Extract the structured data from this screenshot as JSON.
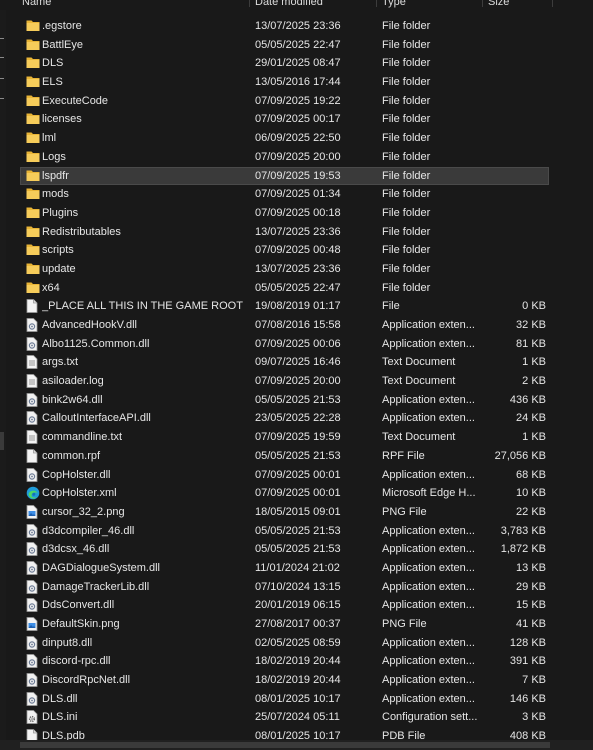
{
  "columns": {
    "name": "Name",
    "date_modified": "Date modified",
    "type": "Type",
    "size": "Size"
  },
  "files": [
    {
      "name": ".egstore",
      "date": "13/07/2025 23:36",
      "type": "File folder",
      "size": "",
      "icon": "folder-icon"
    },
    {
      "name": "BattlEye",
      "date": "05/05/2025 22:47",
      "type": "File folder",
      "size": "",
      "icon": "folder-icon"
    },
    {
      "name": "DLS",
      "date": "29/01/2025 08:47",
      "type": "File folder",
      "size": "",
      "icon": "folder-icon"
    },
    {
      "name": "ELS",
      "date": "13/05/2016 17:44",
      "type": "File folder",
      "size": "",
      "icon": "folder-icon"
    },
    {
      "name": "ExecuteCode",
      "date": "07/09/2025 19:22",
      "type": "File folder",
      "size": "",
      "icon": "folder-icon"
    },
    {
      "name": "licenses",
      "date": "07/09/2025 00:17",
      "type": "File folder",
      "size": "",
      "icon": "folder-icon"
    },
    {
      "name": "lml",
      "date": "06/09/2025 22:50",
      "type": "File folder",
      "size": "",
      "icon": "folder-icon"
    },
    {
      "name": "Logs",
      "date": "07/09/2025 20:00",
      "type": "File folder",
      "size": "",
      "icon": "folder-icon"
    },
    {
      "name": "lspdfr",
      "date": "07/09/2025 19:53",
      "type": "File folder",
      "size": "",
      "icon": "folder-icon",
      "selected": true
    },
    {
      "name": "mods",
      "date": "07/09/2025 01:34",
      "type": "File folder",
      "size": "",
      "icon": "folder-icon"
    },
    {
      "name": "Plugins",
      "date": "07/09/2025 00:18",
      "type": "File folder",
      "size": "",
      "icon": "folder-icon"
    },
    {
      "name": "Redistributables",
      "date": "13/07/2025 23:36",
      "type": "File folder",
      "size": "",
      "icon": "folder-icon"
    },
    {
      "name": "scripts",
      "date": "07/09/2025 00:48",
      "type": "File folder",
      "size": "",
      "icon": "folder-icon"
    },
    {
      "name": "update",
      "date": "13/07/2025 23:36",
      "type": "File folder",
      "size": "",
      "icon": "folder-icon"
    },
    {
      "name": "x64",
      "date": "05/05/2025 22:47",
      "type": "File folder",
      "size": "",
      "icon": "folder-icon"
    },
    {
      "name": "_PLACE ALL THIS IN THE GAME ROOT",
      "date": "19/08/2019 01:17",
      "type": "File",
      "size": "0 KB",
      "icon": "blank-file-icon"
    },
    {
      "name": "AdvancedHookV.dll",
      "date": "07/08/2016 15:58",
      "type": "Application exten...",
      "size": "32 KB",
      "icon": "dll-file-icon"
    },
    {
      "name": "Albo1125.Common.dll",
      "date": "07/09/2025 00:06",
      "type": "Application exten...",
      "size": "81 KB",
      "icon": "dll-file-icon"
    },
    {
      "name": "args.txt",
      "date": "09/07/2025 16:46",
      "type": "Text Document",
      "size": "1 KB",
      "icon": "text-file-icon"
    },
    {
      "name": "asiloader.log",
      "date": "07/09/2025 20:00",
      "type": "Text Document",
      "size": "2 KB",
      "icon": "text-file-icon"
    },
    {
      "name": "bink2w64.dll",
      "date": "05/05/2025 21:53",
      "type": "Application exten...",
      "size": "436 KB",
      "icon": "dll-file-icon"
    },
    {
      "name": "CalloutInterfaceAPI.dll",
      "date": "23/05/2025 22:28",
      "type": "Application exten...",
      "size": "24 KB",
      "icon": "dll-file-icon"
    },
    {
      "name": "commandline.txt",
      "date": "07/09/2025 19:59",
      "type": "Text Document",
      "size": "1 KB",
      "icon": "text-file-icon"
    },
    {
      "name": "common.rpf",
      "date": "05/05/2025 21:53",
      "type": "RPF File",
      "size": "27,056 KB",
      "icon": "blank-file-icon"
    },
    {
      "name": "CopHolster.dll",
      "date": "07/09/2025 00:01",
      "type": "Application exten...",
      "size": "68 KB",
      "icon": "dll-file-icon"
    },
    {
      "name": "CopHolster.xml",
      "date": "07/09/2025 00:01",
      "type": "Microsoft Edge H...",
      "size": "10 KB",
      "icon": "edge-file-icon"
    },
    {
      "name": "cursor_32_2.png",
      "date": "18/05/2015 09:01",
      "type": "PNG File",
      "size": "22 KB",
      "icon": "image-file-icon"
    },
    {
      "name": "d3dcompiler_46.dll",
      "date": "05/05/2025 21:53",
      "type": "Application exten...",
      "size": "3,783 KB",
      "icon": "dll-file-icon"
    },
    {
      "name": "d3dcsx_46.dll",
      "date": "05/05/2025 21:53",
      "type": "Application exten...",
      "size": "1,872 KB",
      "icon": "dll-file-icon"
    },
    {
      "name": "DAGDialogueSystem.dll",
      "date": "11/01/2024 21:02",
      "type": "Application exten...",
      "size": "13 KB",
      "icon": "dll-file-icon"
    },
    {
      "name": "DamageTrackerLib.dll",
      "date": "07/10/2024 13:15",
      "type": "Application exten...",
      "size": "29 KB",
      "icon": "dll-file-icon"
    },
    {
      "name": "DdsConvert.dll",
      "date": "20/01/2019 06:15",
      "type": "Application exten...",
      "size": "15 KB",
      "icon": "dll-file-icon"
    },
    {
      "name": "DefaultSkin.png",
      "date": "27/08/2017 00:37",
      "type": "PNG File",
      "size": "41 KB",
      "icon": "image-file-icon"
    },
    {
      "name": "dinput8.dll",
      "date": "02/05/2025 08:59",
      "type": "Application exten...",
      "size": "128 KB",
      "icon": "dll-file-icon"
    },
    {
      "name": "discord-rpc.dll",
      "date": "18/02/2019 20:44",
      "type": "Application exten...",
      "size": "391 KB",
      "icon": "dll-file-icon"
    },
    {
      "name": "DiscordRpcNet.dll",
      "date": "18/02/2019 20:44",
      "type": "Application exten...",
      "size": "7 KB",
      "icon": "dll-file-icon"
    },
    {
      "name": "DLS.dll",
      "date": "08/01/2025 10:17",
      "type": "Application exten...",
      "size": "146 KB",
      "icon": "dll-file-icon"
    },
    {
      "name": "DLS.ini",
      "date": "25/07/2024 05:11",
      "type": "Configuration sett...",
      "size": "3 KB",
      "icon": "config-file-icon"
    },
    {
      "name": "DLS.pdb",
      "date": "08/01/2025 10:17",
      "type": "PDB File",
      "size": "408 KB",
      "icon": "blank-file-icon"
    }
  ],
  "colors": {
    "background": "#191919",
    "text": "#e6e6e6",
    "selection": "#3a3a3a",
    "folder": "#f0c34e"
  }
}
